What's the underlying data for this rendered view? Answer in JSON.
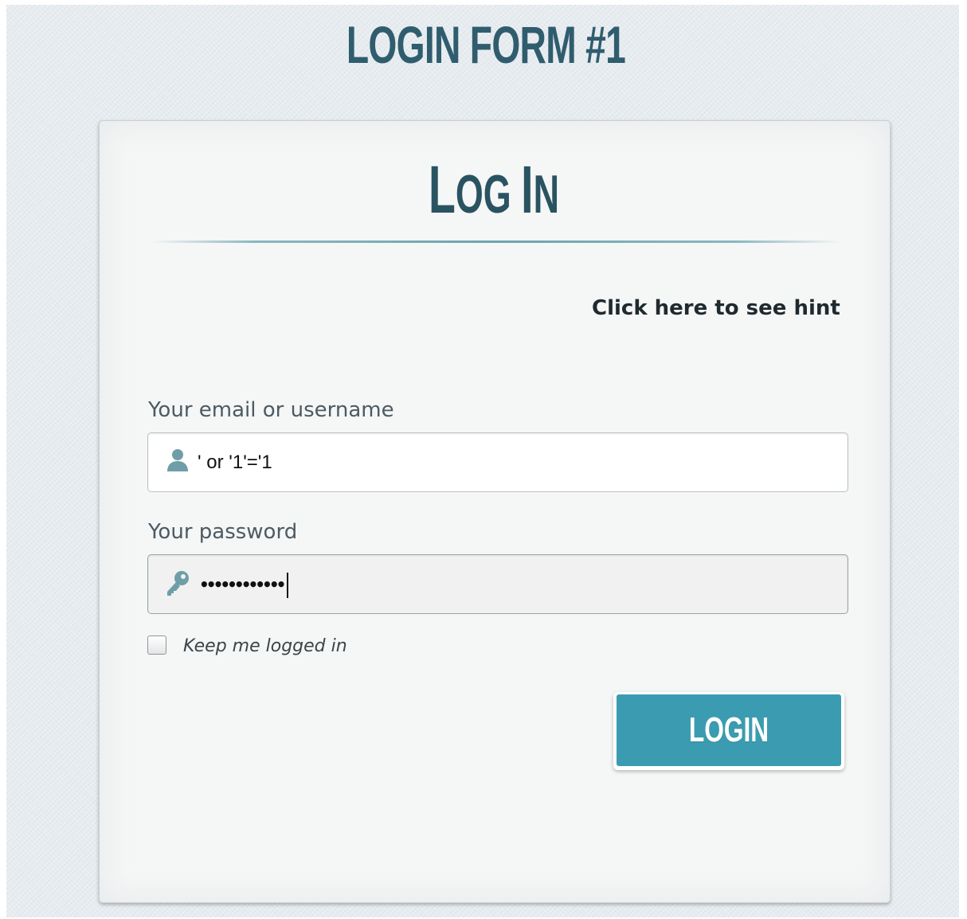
{
  "page": {
    "title": "LOGIN FORM #1"
  },
  "card": {
    "title_first_letter": "L",
    "title_rest_og": "OG ",
    "title_i": "I",
    "title_n": "N",
    "hint_link": "Click here to see hint"
  },
  "username_field": {
    "label": "Your email or username",
    "value": "' or '1'='1",
    "icon": "user-icon"
  },
  "password_field": {
    "label": "Your password",
    "masked_value": "••••••••••••",
    "icon": "key-icon"
  },
  "remember": {
    "label": "Keep me logged in",
    "checked": false
  },
  "login_button": {
    "label": "LOGIN"
  },
  "colors": {
    "accent": "#3b9cb1",
    "title": "#2f5d6e",
    "background": "#e6ebef",
    "card": "#f5f6f6"
  }
}
